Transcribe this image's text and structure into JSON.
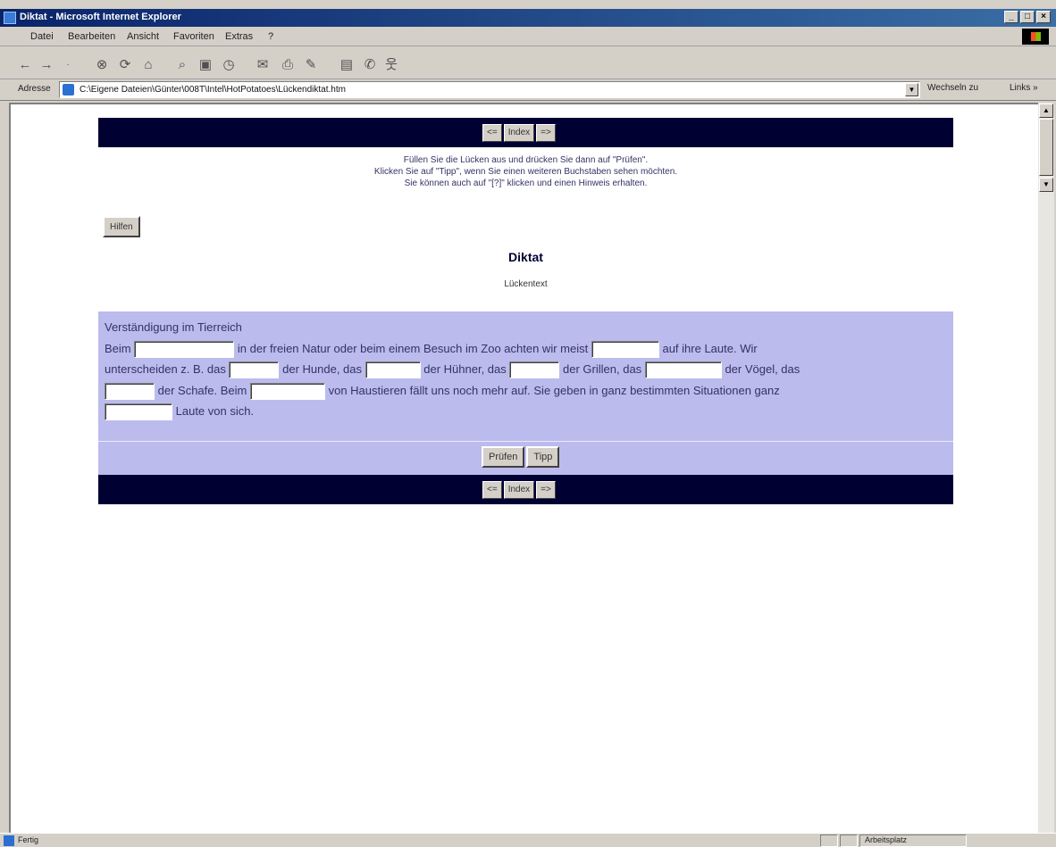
{
  "window": {
    "title": "Diktat - Microsoft Internet Explorer",
    "controls": [
      "_",
      "□",
      "×"
    ]
  },
  "menu": [
    "Datei",
    "Bearbeiten",
    "Ansicht",
    "Favoriten",
    "Extras",
    "?"
  ],
  "toolbar_icons": [
    "back-icon",
    "forward-icon",
    "stop-icon",
    "refresh-icon",
    "home-icon",
    "search-icon",
    "favorites-icon",
    "history-icon",
    "mail-icon",
    "print-icon",
    "edit-icon",
    "discuss-icon",
    "messenger-icon"
  ],
  "address": {
    "label": "Adresse",
    "url": "C:\\Eigene Dateien\\Günter\\008T\\Intel\\HotPotatoes\\Lückendiktat.htm",
    "go_label": "Wechseln zu",
    "links_label": "Links »"
  },
  "nav": {
    "back": "<=",
    "index": "Index",
    "forward": "=>"
  },
  "instructions": [
    "Füllen Sie die Lücken aus und drücken Sie dann auf \"Prüfen\".",
    "Klicken Sie auf \"Tipp\", wenn Sie einen weiteren Buchstaben sehen möchten.",
    "Sie können auch auf \"[?]\" klicken und einen Hinweis erhalten."
  ],
  "hint_button": "Hilfen",
  "exercise": {
    "title": "Diktat",
    "subtitle": "Lückentext",
    "heading": "Verständigung im Tierreich",
    "segments": [
      "Beim",
      "in der freien Natur oder beim einem Besuch im Zoo achten wir meist",
      "auf ihre Laute. Wir",
      "unterscheiden z. B. das",
      "der Hunde, das",
      "der Hühner, das",
      "der Grillen, das",
      "der Vögel, das",
      "der Schafe. Beim",
      "von Haustieren fällt uns noch mehr auf. Sie geben in ganz bestimmten Situationen ganz",
      "Laute von sich."
    ],
    "check_button": "Prüfen",
    "tip_button": "Tipp"
  },
  "status": {
    "text": "Fertig",
    "zone": "Arbeitsplatz"
  }
}
